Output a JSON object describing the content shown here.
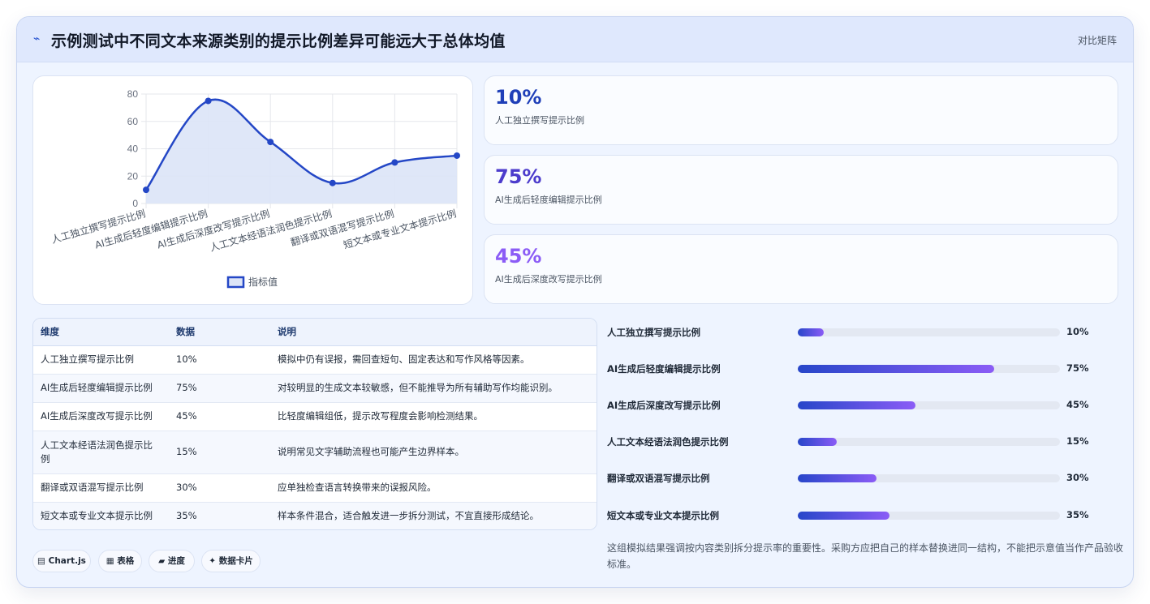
{
  "header": {
    "icon": "⌁",
    "title": "示例测试中不同文本来源类别的提示比例差异可能远大于总体均值",
    "right_label": "对比矩阵"
  },
  "chart_data": {
    "type": "line",
    "categories": [
      "人工独立撰写提示比例",
      "AI生成后轻度编辑提示比例",
      "AI生成后深度改写提示比例",
      "人工文本经语法润色提示比例",
      "翻译或双语混写提示比例",
      "短文本或专业文本提示比例"
    ],
    "series": [
      {
        "name": "指标值",
        "values": [
          10,
          75,
          45,
          15,
          30,
          35
        ]
      }
    ],
    "ylim": [
      0,
      80
    ],
    "yticks": [
      "0",
      "20",
      "40",
      "60",
      "80"
    ],
    "legend": "bottom",
    "grid": true,
    "colors": {
      "line": "#2447c6",
      "fill": "#dce4f7"
    }
  },
  "stats": [
    {
      "value": "10%",
      "label": "人工独立撰写提示比例",
      "color": "#1f3fb8"
    },
    {
      "value": "75%",
      "label": "AI生成后轻度编辑提示比例",
      "color": "#4c3ccc"
    },
    {
      "value": "45%",
      "label": "AI生成后深度改写提示比例",
      "color": "#8b5cf6"
    }
  ],
  "table": {
    "headers": [
      "维度",
      "数据",
      "说明"
    ],
    "rows": [
      [
        "人工独立撰写提示比例",
        "10%",
        "模拟中仍有误报，需回查短句、固定表达和写作风格等因素。"
      ],
      [
        "AI生成后轻度编辑提示比例",
        "75%",
        "对较明显的生成文本较敏感，但不能推导为所有辅助写作均能识别。"
      ],
      [
        "AI生成后深度改写提示比例",
        "45%",
        "比轻度编辑组低，提示改写程度会影响检测结果。"
      ],
      [
        "人工文本经语法润色提示比例",
        "15%",
        "说明常见文字辅助流程也可能产生边界样本。"
      ],
      [
        "翻译或双语混写提示比例",
        "30%",
        "应单独检查语言转换带来的误报风险。"
      ],
      [
        "短文本或专业文本提示比例",
        "35%",
        "样本条件混合，适合触发进一步拆分测试，不宜直接形成结论。"
      ]
    ]
  },
  "chips": [
    "▤ Chart.js",
    "▦ 表格",
    "▰ 进度",
    "✦ 数据卡片"
  ],
  "bars": [
    {
      "label": "人工独立撰写提示比例",
      "value": 10,
      "text": "10%"
    },
    {
      "label": "AI生成后轻度编辑提示比例",
      "value": 75,
      "text": "75%"
    },
    {
      "label": "AI生成后深度改写提示比例",
      "value": 45,
      "text": "45%"
    },
    {
      "label": "人工文本经语法润色提示比例",
      "value": 15,
      "text": "15%"
    },
    {
      "label": "翻译或双语混写提示比例",
      "value": 30,
      "text": "30%"
    },
    {
      "label": "短文本或专业文本提示比例",
      "value": 35,
      "text": "35%"
    }
  ],
  "note": "这组模拟结果强调按内容类别拆分提示率的重要性。采购方应把自己的样本替换进同一结构，不能把示意值当作产品验收标准。"
}
